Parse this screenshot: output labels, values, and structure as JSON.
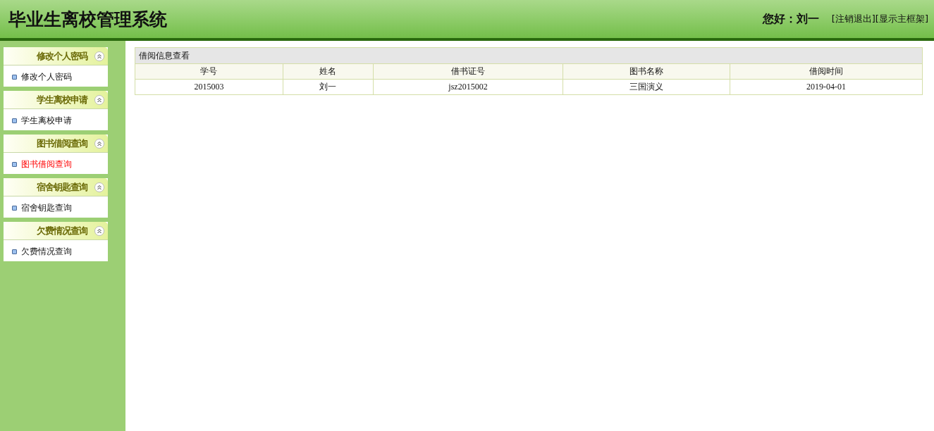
{
  "header": {
    "title": "毕业生离校管理系统",
    "greeting": "您好：刘一",
    "links": [
      "[注销退出]",
      "[显示主框架]"
    ]
  },
  "sidebar": {
    "groups": [
      {
        "title": "修改个人密码",
        "expanded": true,
        "items": [
          {
            "label": "修改个人密码",
            "selected": false
          }
        ]
      },
      {
        "title": "学生离校申请",
        "expanded": true,
        "items": [
          {
            "label": "学生离校申请",
            "selected": false
          }
        ]
      },
      {
        "title": "图书借阅查询",
        "expanded": true,
        "items": [
          {
            "label": "图书借阅查询",
            "selected": true
          }
        ]
      },
      {
        "title": "宿舍钥匙查询",
        "expanded": true,
        "items": [
          {
            "label": "宿舍钥匙查询",
            "selected": false
          }
        ]
      },
      {
        "title": "欠费情况查询",
        "expanded": true,
        "items": [
          {
            "label": "欠费情况查询",
            "selected": false
          }
        ]
      }
    ]
  },
  "table": {
    "caption": "借阅信息查看",
    "columns": [
      "学号",
      "姓名",
      "借书证号",
      "图书名称",
      "借阅时间"
    ],
    "rows": [
      [
        "2015003",
        "刘一",
        "jsz2015002",
        "三国演义",
        "2019-04-01"
      ]
    ]
  }
}
